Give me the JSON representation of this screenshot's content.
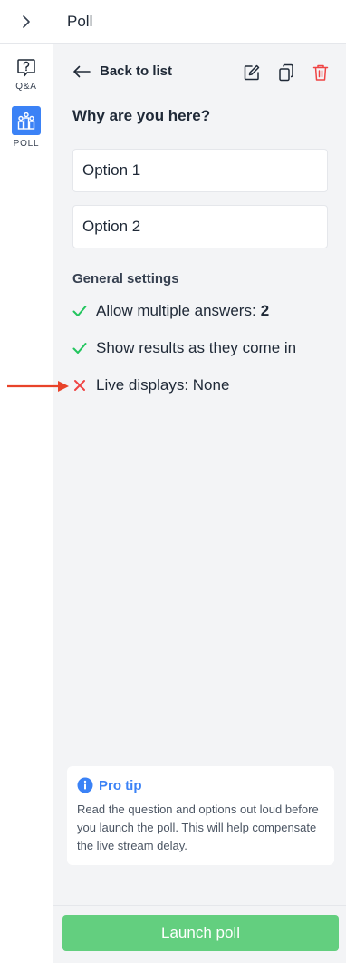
{
  "sidebar": {
    "toggle_icon": "chevron-right-icon",
    "items": [
      {
        "label": "Q&A",
        "icon": "question-bubble-icon"
      },
      {
        "label": "POLL",
        "icon": "poll-icon"
      }
    ],
    "active_color": "#3b82f6"
  },
  "header": {
    "title": "Poll"
  },
  "poll_editor": {
    "back_label": "Back to list",
    "actions": [
      "edit-icon",
      "duplicate-icon",
      "delete-icon"
    ],
    "question": "Why are you here?",
    "options": [
      "Option 1",
      "Option 2"
    ],
    "settings_title": "General settings",
    "settings": [
      {
        "label": "Allow multiple answers:",
        "value": "2",
        "enabled": true
      },
      {
        "label": "Show results as they come in",
        "enabled": true
      },
      {
        "label": "Live displays: None",
        "enabled": false
      }
    ]
  },
  "pro_tip": {
    "title": "Pro tip",
    "text": "Read the question and options out loud before you launch the poll. This will help compensate the live stream delay."
  },
  "footer": {
    "launch_label": "Launch poll"
  },
  "colors": {
    "check": "#22c55e",
    "cross": "#ef4444",
    "annotation_arrow": "#e8432a",
    "launch_button": "#63cf7f"
  }
}
